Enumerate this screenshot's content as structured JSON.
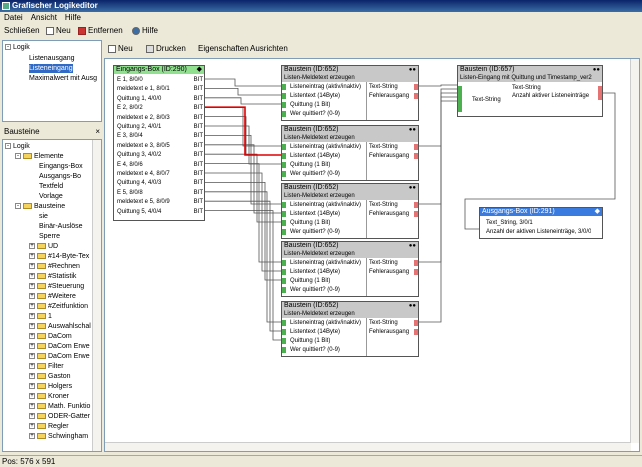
{
  "window": {
    "title": "Grafischer Logikeditor"
  },
  "menu": [
    "Datei",
    "Ansicht",
    "Hilfe"
  ],
  "toolbar": {
    "close": "Schließen",
    "new": "Neu",
    "remove": "Entfernen",
    "help": "Hilfe"
  },
  "editor_toolbar": {
    "new": "Neu",
    "print": "Drucken",
    "properties": "Eigenschaften",
    "align": "Ausrichten"
  },
  "logic_tree": {
    "root": "Logik",
    "items": [
      "Listenausgang",
      "Listeneingang",
      "Maximalwert mit Ausg"
    ]
  },
  "blocks_panel": {
    "title": "Bausteine"
  },
  "blocks_tree": {
    "root": "Logik",
    "elements": "Elemente",
    "element_items": [
      "Eingangs-Box",
      "Ausgangs-Bo",
      "Textfeld",
      "Vorlage"
    ],
    "blocks": "Bausteine",
    "block_items": [
      "sie",
      "Binär-Auslöse",
      "Sperre"
    ],
    "folders": [
      "UD",
      "#14-Byte-Tex",
      "#Rechnen",
      "#Statistik",
      "#Steuerung",
      "#Weitere",
      "#Zeitfunktion",
      "1",
      "Auswahlschal",
      "DaCom",
      "DaCom Erwe",
      "DaCom Erwe",
      "Filter",
      "Gaston",
      "Holgers",
      "Kroner",
      "Math. Funktio",
      "ODER-Gatter",
      "Regler",
      "Schwingham"
    ]
  },
  "input_box": {
    "title": "Eingangs-Box (ID:290)",
    "rows": [
      "E 1, 8/0/0",
      "meldetext e 1, 8/0/1",
      "Quittung 1, 4/0/0",
      "E 2, 8/0/2",
      "meldetext e 2, 8/0/3",
      "Quittung 2, 4/0/1",
      "E 3, 8/0/4",
      "meldetext e 3, 8/0/5",
      "Quittung 3, 4/0/2",
      "E 4, 8/0/6",
      "meldetext e 4, 8/0/7",
      "Quittung 4, 4/0/3",
      "E 5, 8/0/8",
      "meldetext e 5, 8/0/9",
      "Quittung 5, 4/0/4"
    ],
    "pin_label": "BIT"
  },
  "list_block": {
    "title": "Baustein (ID:652)",
    "subtitle": "Listen-Meldetext erzeugen",
    "inputs": [
      "Listeneintrag (aktiv/inaktiv)",
      "Listentext (14Byte)",
      "Quittung (1 Bit)",
      "Wer quittiert? (0-9)"
    ],
    "outputs": [
      "Text-String",
      "Fehlerausgang"
    ]
  },
  "merge_block": {
    "title": "Baustein (ID:657)",
    "subtitle": "Listen-Eingang mit  Quittung und Timestamp_ver2",
    "input": "Text-String",
    "outputs": [
      "Text-String",
      "Anzahl aktiver Listeneinträge"
    ]
  },
  "output_box": {
    "title": "Ausgangs-Box (ID:291)",
    "rows": [
      "Text_String, 3/0/1",
      "Anzahl der aktiven Listeneinträge, 3/0/0"
    ]
  },
  "status": {
    "position": "Pos: 576 x 591"
  },
  "colors": {
    "titlebar": "#0a246a",
    "input_box_head": "#90e090",
    "output_box_head": "#3a7be0",
    "wire_highlight": "#e00000"
  }
}
